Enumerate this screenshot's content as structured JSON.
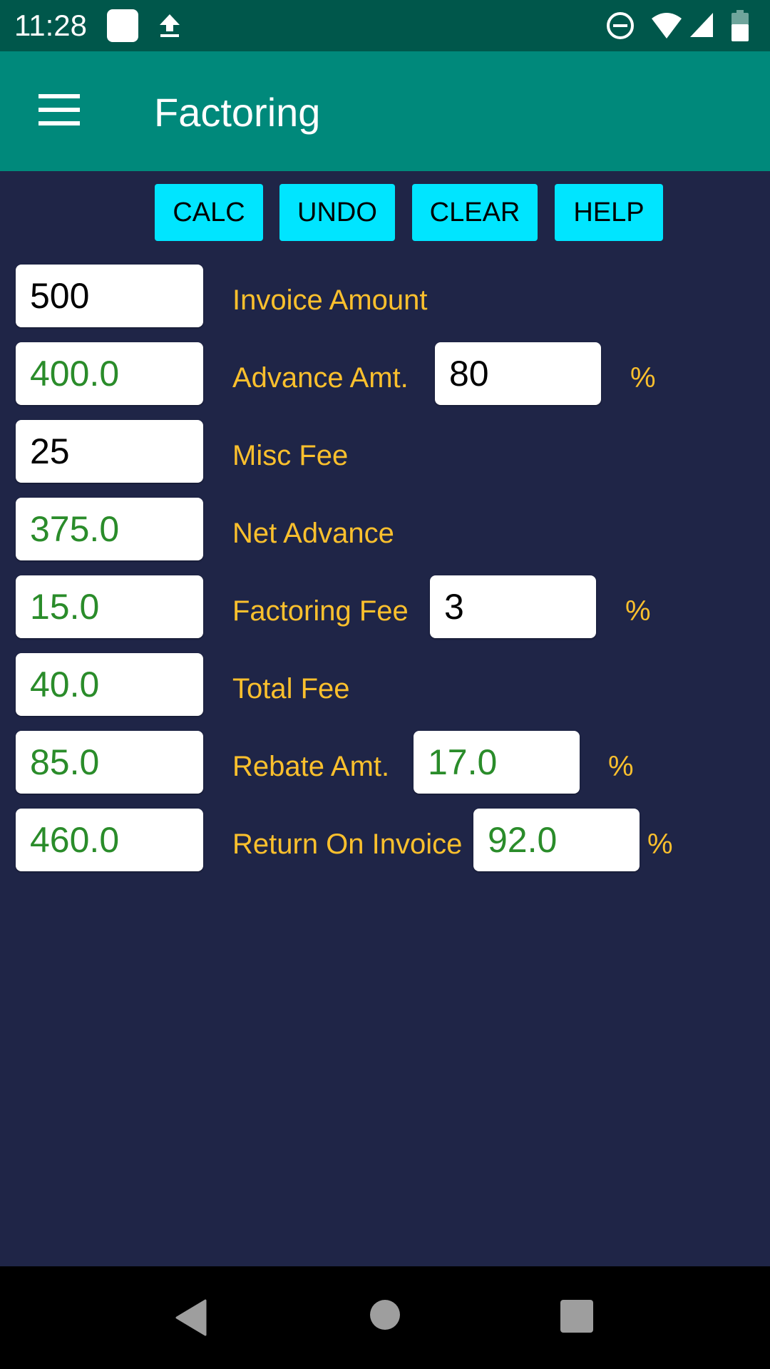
{
  "status_bar": {
    "time": "11:28",
    "left_icons": [
      "notification-square-icon",
      "upload-icon"
    ],
    "right_icons": [
      "do-not-disturb-icon",
      "wifi-icon",
      "cell-signal-icon",
      "battery-icon"
    ]
  },
  "app_bar": {
    "menu_icon": "hamburger-menu-icon",
    "title": "Factoring"
  },
  "toolbar": {
    "calc_label": "CALC",
    "undo_label": "UNDO",
    "clear_label": "CLEAR",
    "help_label": "HELP"
  },
  "form": {
    "invoice_amount": {
      "value": "500",
      "label": "Invoice Amount"
    },
    "advance_amt": {
      "value": "400.0",
      "label": "Advance Amt.",
      "percent_value": "80",
      "percent_sign": "%"
    },
    "misc_fee": {
      "value": "25",
      "label": "Misc Fee"
    },
    "net_advance": {
      "value": "375.0",
      "label": "Net Advance"
    },
    "factoring_fee": {
      "value": "15.0",
      "label": "Factoring Fee",
      "percent_value": "3",
      "percent_sign": "%"
    },
    "total_fee": {
      "value": "40.0",
      "label": "Total Fee"
    },
    "rebate_amt": {
      "value": "85.0",
      "label": "Rebate Amt.",
      "percent_value": "17.0",
      "percent_sign": "%"
    },
    "return_on_invoice": {
      "value": "460.0",
      "label": "Return On Invoice",
      "percent_value": "92.0",
      "percent_sign": "%"
    }
  },
  "colors": {
    "status_bar": "#00574b",
    "app_bar": "#00897b",
    "background": "#1f2547",
    "button": "#00e5ff",
    "label": "#fbc02d",
    "computed_value": "#2a8c2a"
  },
  "nav_bar": {
    "icons": [
      "back-icon",
      "home-icon",
      "recents-icon"
    ]
  }
}
